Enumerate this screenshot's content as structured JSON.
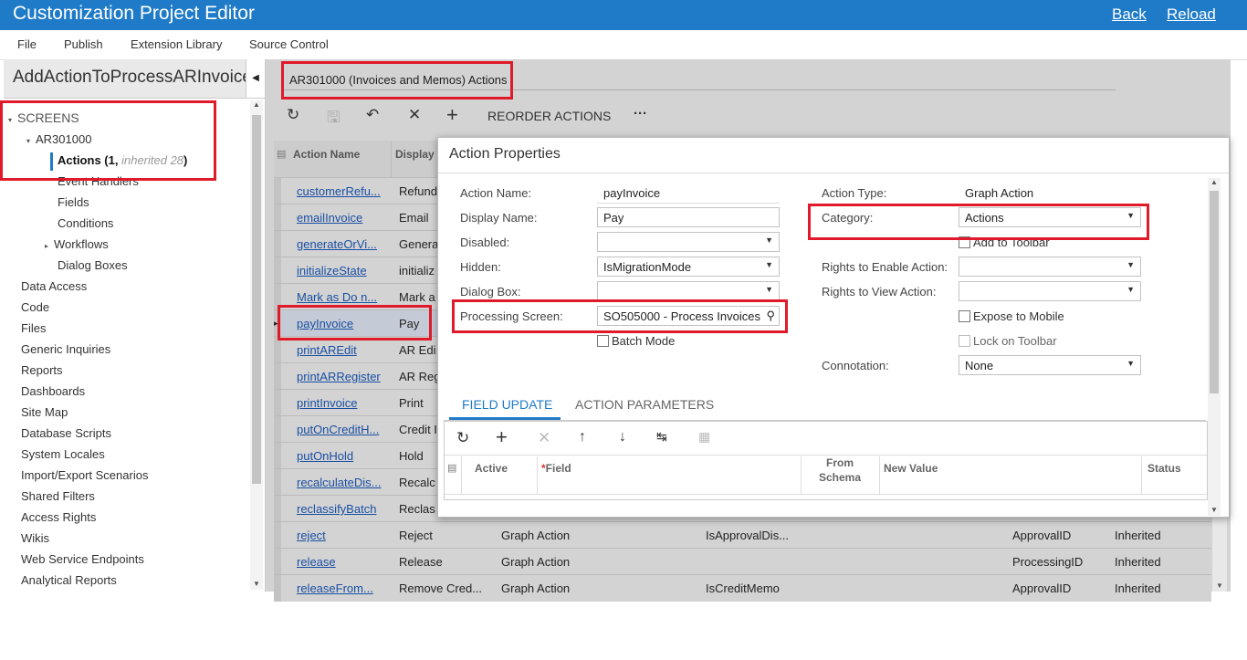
{
  "titlebar": {
    "title": "Customization Project Editor",
    "back": "Back",
    "reload": "Reload"
  },
  "menubar": {
    "items": [
      "File",
      "Publish",
      "Extension Library",
      "Source Control"
    ]
  },
  "project": {
    "name": "AddActionToProcessARInvoice"
  },
  "tree": {
    "screens": "SCREENS",
    "screen_id": "AR301000",
    "actions_label": "Actions",
    "actions_count": "(1, ",
    "actions_inherited": "inherited 28",
    "actions_close": ")",
    "children": [
      "Event Handlers",
      "Fields",
      "Conditions",
      "Workflows",
      "Dialog Boxes"
    ],
    "nodes": [
      "Data Access",
      "Code",
      "Files",
      "Generic Inquiries",
      "Reports",
      "Dashboards",
      "Site Map",
      "Database Scripts",
      "System Locales",
      "Import/Export Scenarios",
      "Shared Filters",
      "Access Rights",
      "Wikis",
      "Web Service Endpoints",
      "Analytical Reports"
    ]
  },
  "screen": {
    "header": "AR301000 (Invoices and Memos) Actions",
    "toolbar": {
      "reorder": "REORDER ACTIONS",
      "more": "···"
    }
  },
  "grid": {
    "columns": {
      "action_name": "Action Name",
      "display": "Display"
    },
    "rows": [
      {
        "name": "customerRefu...",
        "display": "Refund"
      },
      {
        "name": "emailInvoice",
        "display": "Email"
      },
      {
        "name": "generateOrVi...",
        "display": "Genera"
      },
      {
        "name": "initializeState",
        "display": "initializ"
      },
      {
        "name": "Mark as Do n...",
        "display": "Mark a"
      },
      {
        "name": "payInvoice",
        "display": "Pay"
      },
      {
        "name": "printAREdit",
        "display": "AR Edi"
      },
      {
        "name": "printARRegister",
        "display": "AR Reg"
      },
      {
        "name": "printInvoice",
        "display": "Print"
      },
      {
        "name": "putOnCreditH...",
        "display": "Credit I"
      },
      {
        "name": "putOnHold",
        "display": "Hold"
      },
      {
        "name": "recalculateDis...",
        "display": "Recalc"
      },
      {
        "name": "reclassifyBatch",
        "display": "Reclas"
      },
      {
        "name": "reject",
        "display": "Reject",
        "type": "Graph Action",
        "cond": "IsApprovalDis...",
        "field": "ApprovalID",
        "status": "Inherited"
      },
      {
        "name": "release",
        "display": "Release",
        "type": "Graph Action",
        "cond": "",
        "field": "ProcessingID",
        "status": "Inherited"
      },
      {
        "name": "releaseFrom...",
        "display": "Remove Cred...",
        "type": "Graph Action",
        "cond": "IsCreditMemo",
        "field": "ApprovalID",
        "status": "Inherited"
      }
    ]
  },
  "dialog": {
    "title": "Action Properties",
    "action_name_label": "Action Name:",
    "action_name": "payInvoice",
    "display_name_label": "Display Name:",
    "display_name": "Pay",
    "disabled_label": "Disabled:",
    "disabled": "",
    "hidden_label": "Hidden:",
    "hidden": "IsMigrationMode",
    "dialog_box_label": "Dialog Box:",
    "dialog_box": "",
    "processing_screen_label": "Processing Screen:",
    "processing_screen": "SO505000 - Process Invoices",
    "batch_mode": "Batch Mode",
    "action_type_label": "Action Type:",
    "action_type": "Graph Action",
    "category_label": "Category:",
    "category": "Actions",
    "add_to_toolbar": "Add to Toolbar",
    "rights_enable_label": "Rights to Enable Action:",
    "rights_enable": "",
    "rights_view_label": "Rights to View Action:",
    "rights_view": "",
    "expose_mobile": "Expose to Mobile",
    "lock_toolbar": "Lock on Toolbar",
    "connotation_label": "Connotation:",
    "connotation": "None",
    "tabs": [
      "FIELD UPDATE",
      "ACTION PARAMETERS"
    ],
    "subgrid": {
      "active": "Active",
      "field_required": "*",
      "field": "Field",
      "from_schema_1": "From",
      "from_schema_2": "Schema",
      "new_value": "New Value",
      "status": "Status"
    }
  },
  "colors": {
    "accent": "#1f7bc8",
    "highlight": "#e01a2a",
    "link": "#1a4fa3"
  }
}
